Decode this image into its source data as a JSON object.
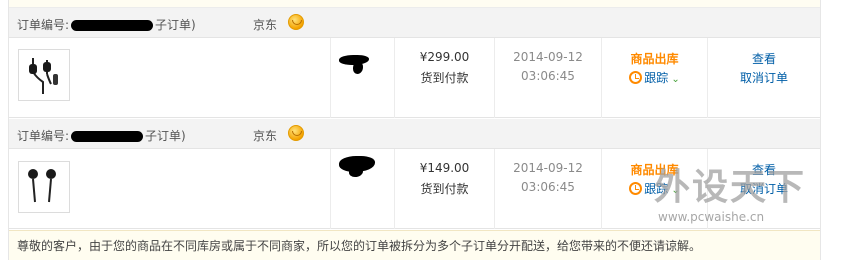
{
  "orders": [
    {
      "label_prefix": "订单编号:",
      "label_suffix": "子订单)",
      "shop": "京东",
      "price": "¥299.00",
      "payment": "货到付款",
      "date": "2014-09-12",
      "time": "03:06:45",
      "status": "商品出库",
      "track": "跟踪",
      "view": "查看",
      "cancel": "取消订单"
    },
    {
      "label_prefix": "订单编号:",
      "label_suffix": "子订单)",
      "shop": "京东",
      "price": "¥149.00",
      "payment": "货到付款",
      "date": "2014-09-12",
      "time": "03:06:45",
      "status": "商品出库",
      "track": "跟踪",
      "view": "查看",
      "cancel": "取消订单"
    }
  ],
  "notice": "尊敬的客户，由于您的商品在不同库房或属于不同商家，所以您的订单被拆分为多个子订单分开配送，给您带来的不便还请谅解。",
  "watermark": {
    "main": "外设天下",
    "url": "www.pcwaishe.cn"
  },
  "colors": {
    "status": "#ff8a00",
    "link": "#005ea7",
    "header_bg": "#f3f3f3",
    "notice_bg": "#fffdf0"
  },
  "icons": [
    "shop-coin-icon",
    "clock-icon",
    "chevron-down-icon",
    "earphone-thumbnail"
  ]
}
